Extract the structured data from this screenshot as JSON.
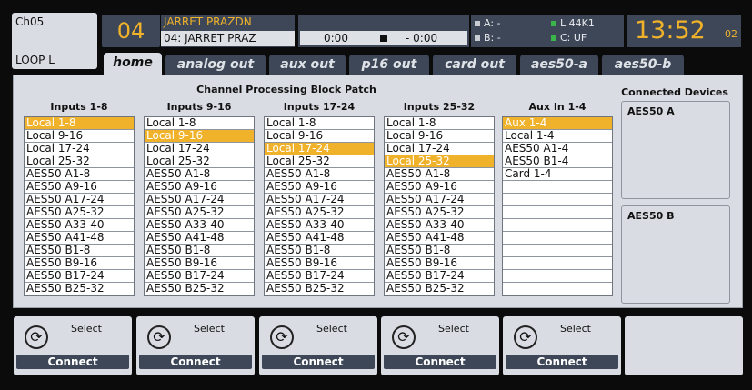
{
  "header": {
    "channel": "Ch05",
    "channel_sub": "LOOP L",
    "number": "04",
    "name_top": "JARRET PRAZDN",
    "name_bottom": "04: JARRET PRAZ",
    "time_left": "0:00",
    "time_right": "- 0:00",
    "src_a": "A:   -",
    "src_b": "B:   -",
    "src_l": "L  44K1",
    "src_c": "C:  UF",
    "clock": "13:52",
    "clock_sec": "02"
  },
  "tabs": [
    "home",
    "analog out",
    "aux out",
    "p16 out",
    "card out",
    "aes50-a",
    "aes50-b"
  ],
  "panel": {
    "title": "Channel Processing Block Patch",
    "devices_title": "Connected Devices",
    "device_a": "AES50 A",
    "device_b": "AES50 B"
  },
  "columns": [
    {
      "header": "Inputs 1-8",
      "items": [
        "Local 1-8",
        "Local 9-16",
        "Local 17-24",
        "Local 25-32",
        "AES50 A1-8",
        "AES50 A9-16",
        "AES50 A17-24",
        "AES50 A25-32",
        "AES50 A33-40",
        "AES50 A41-48",
        "AES50 B1-8",
        "AES50 B9-16",
        "AES50 B17-24",
        "AES50 B25-32"
      ],
      "selected": 0
    },
    {
      "header": "Inputs 9-16",
      "items": [
        "Local 1-8",
        "Local 9-16",
        "Local 17-24",
        "Local 25-32",
        "AES50 A1-8",
        "AES50 A9-16",
        "AES50 A17-24",
        "AES50 A25-32",
        "AES50 A33-40",
        "AES50 A41-48",
        "AES50 B1-8",
        "AES50 B9-16",
        "AES50 B17-24",
        "AES50 B25-32"
      ],
      "selected": 1
    },
    {
      "header": "Inputs 17-24",
      "items": [
        "Local 1-8",
        "Local 9-16",
        "Local 17-24",
        "Local 25-32",
        "AES50 A1-8",
        "AES50 A9-16",
        "AES50 A17-24",
        "AES50 A25-32",
        "AES50 A33-40",
        "AES50 A41-48",
        "AES50 B1-8",
        "AES50 B9-16",
        "AES50 B17-24",
        "AES50 B25-32"
      ],
      "selected": 2
    },
    {
      "header": "Inputs 25-32",
      "items": [
        "Local 1-8",
        "Local 9-16",
        "Local 17-24",
        "Local 25-32",
        "AES50 A1-8",
        "AES50 A9-16",
        "AES50 A17-24",
        "AES50 A25-32",
        "AES50 A33-40",
        "AES50 A41-48",
        "AES50 B1-8",
        "AES50 B9-16",
        "AES50 B17-24",
        "AES50 B25-32"
      ],
      "selected": 3
    },
    {
      "header": "Aux In 1-4",
      "items": [
        "Aux 1-4",
        "Local 1-4",
        "AES50 A1-4",
        "AES50 B1-4",
        "Card 1-4",
        "",
        "",
        "",
        "",
        "",
        "",
        "",
        "",
        ""
      ],
      "selected": 0
    }
  ],
  "buttons": [
    {
      "select": "Select",
      "connect": "Connect"
    },
    {
      "select": "Select",
      "connect": "Connect"
    },
    {
      "select": "Select",
      "connect": "Connect"
    },
    {
      "select": "Select",
      "connect": "Connect"
    },
    {
      "select": "Select",
      "connect": "Connect"
    }
  ],
  "colors": {
    "accent": "#f0b22a",
    "panel": "#d9dde3",
    "dark": "#3d4757"
  }
}
